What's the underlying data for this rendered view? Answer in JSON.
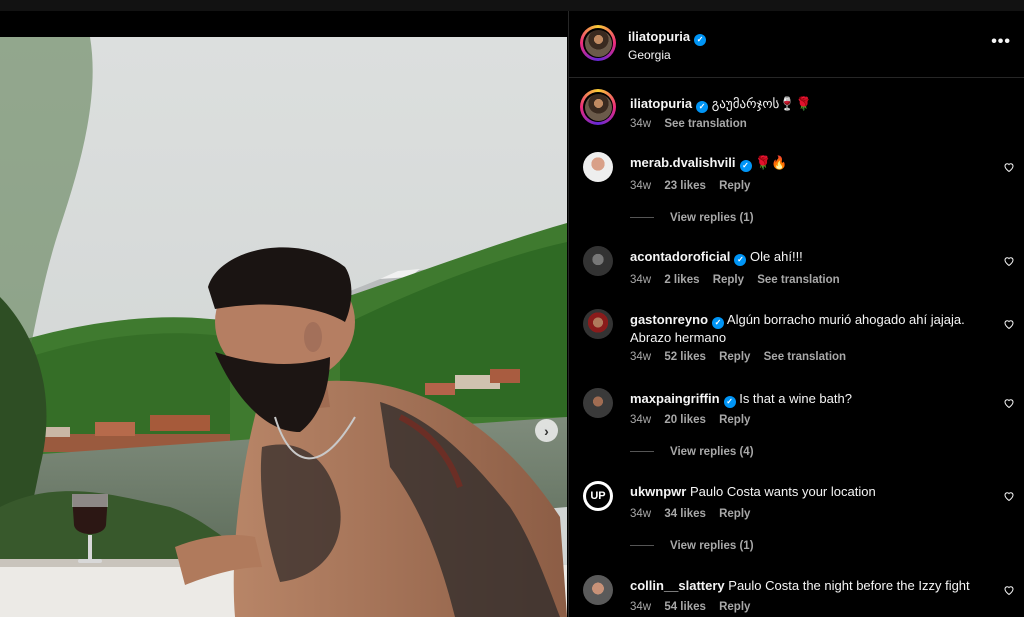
{
  "post": {
    "username": "iliatopuria",
    "location": "Georgia"
  },
  "caption": {
    "username": "iliatopuria",
    "text": "გაუმარჯოს🍷🌹",
    "time": "34w",
    "translate": "See translation"
  },
  "comments": [
    {
      "username": "merab.dvalishvili",
      "verified": true,
      "text": "🌹🔥",
      "time": "34w",
      "likes": "23 likes",
      "reply": "Reply",
      "translate": "",
      "view_replies": "View replies (1)"
    },
    {
      "username": "acontadoroficial",
      "verified": true,
      "text": "Ole ahí!!!",
      "time": "34w",
      "likes": "2 likes",
      "reply": "Reply",
      "translate": "See translation",
      "view_replies": ""
    },
    {
      "username": "gastonreyno",
      "verified": true,
      "text": "Algún borracho murió ahogado ahí jajaja. Abrazo hermano",
      "time": "34w",
      "likes": "52 likes",
      "reply": "Reply",
      "translate": "See translation",
      "view_replies": ""
    },
    {
      "username": "maxpaingriffin",
      "verified": true,
      "text": "Is that a wine bath?",
      "time": "34w",
      "likes": "20 likes",
      "reply": "Reply",
      "translate": "",
      "view_replies": "View replies (4)"
    },
    {
      "username": "ukwnpwr",
      "verified": false,
      "text": "Paulo Costa wants your location",
      "time": "34w",
      "likes": "34 likes",
      "reply": "Reply",
      "translate": "",
      "view_replies": "View replies (1)"
    },
    {
      "username": "collin__slattery",
      "verified": false,
      "text": "Paulo Costa the night before the Izzy fight",
      "time": "34w",
      "likes": "54 likes",
      "reply": "Reply",
      "translate": "",
      "view_replies": ""
    }
  ],
  "icons": {
    "more": "more-options-icon",
    "heart": "heart-icon",
    "verified": "verified-badge-icon",
    "next": "chevron-right-icon"
  },
  "colors": {
    "background": "#000000",
    "verified": "#0095f6",
    "muted_text": "#a8a8a8"
  }
}
